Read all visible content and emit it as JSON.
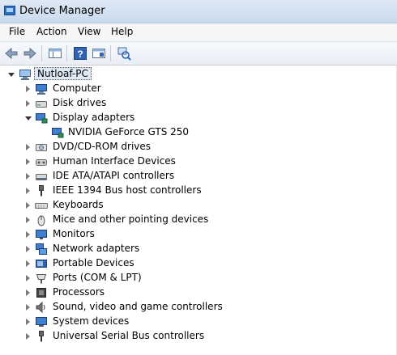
{
  "window": {
    "title": "Device Manager"
  },
  "menu": [
    "File",
    "Action",
    "View",
    "Help"
  ],
  "toolbar": {
    "buttons": [
      "back-icon",
      "forward-icon",
      "show-hide-console-tree-icon",
      "help-icon",
      "properties-icon",
      "scan-hardware-icon"
    ]
  },
  "tree": {
    "root": "Nutloaf-PC",
    "categories": [
      {
        "label": "Computer",
        "icon": "computer-icon",
        "expanded": false
      },
      {
        "label": "Disk drives",
        "icon": "disk-drive-icon",
        "expanded": false
      },
      {
        "label": "Display adapters",
        "icon": "display-adapter-icon",
        "expanded": true,
        "children": [
          {
            "label": "NVIDIA GeForce GTS 250",
            "icon": "display-adapter-icon"
          }
        ]
      },
      {
        "label": "DVD/CD-ROM drives",
        "icon": "dvd-drive-icon",
        "expanded": false
      },
      {
        "label": "Human Interface Devices",
        "icon": "hid-icon",
        "expanded": false
      },
      {
        "label": "IDE ATA/ATAPI controllers",
        "icon": "ide-controller-icon",
        "expanded": false
      },
      {
        "label": "IEEE 1394 Bus host controllers",
        "icon": "ieee1394-icon",
        "expanded": false
      },
      {
        "label": "Keyboards",
        "icon": "keyboard-icon",
        "expanded": false
      },
      {
        "label": "Mice and other pointing devices",
        "icon": "mouse-icon",
        "expanded": false
      },
      {
        "label": "Monitors",
        "icon": "monitor-icon",
        "expanded": false
      },
      {
        "label": "Network adapters",
        "icon": "network-adapter-icon",
        "expanded": false
      },
      {
        "label": "Portable Devices",
        "icon": "portable-device-icon",
        "expanded": false
      },
      {
        "label": "Ports (COM & LPT)",
        "icon": "port-icon",
        "expanded": false
      },
      {
        "label": "Processors",
        "icon": "processor-icon",
        "expanded": false
      },
      {
        "label": "Sound, video and game controllers",
        "icon": "sound-icon",
        "expanded": false
      },
      {
        "label": "System devices",
        "icon": "system-devices-icon",
        "expanded": false
      },
      {
        "label": "Universal Serial Bus controllers",
        "icon": "usb-icon",
        "expanded": false
      }
    ]
  }
}
